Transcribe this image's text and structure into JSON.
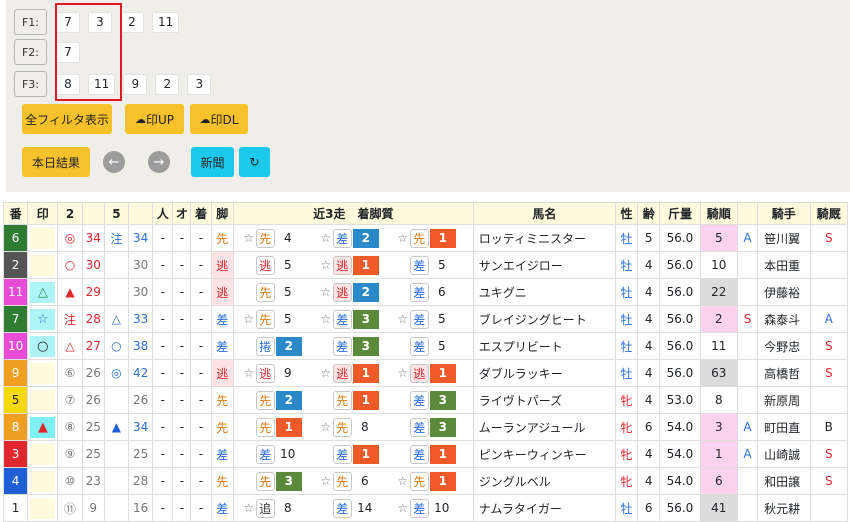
{
  "filters": [
    {
      "label": "F1:",
      "values": [
        "7",
        "3",
        "2",
        "11"
      ]
    },
    {
      "label": "F2:",
      "values": [
        "7"
      ]
    },
    {
      "label": "F3:",
      "values": [
        "8",
        "11",
        "9",
        "2",
        "3"
      ]
    }
  ],
  "buttons": {
    "show_all_filters": "全フィルタ表示",
    "upload": "印UP",
    "download": "印DL",
    "today_results": "本日結果",
    "prev": "←",
    "next": "→",
    "newspaper": "新聞",
    "refresh": "↻"
  },
  "table": {
    "headers": [
      "番",
      "印",
      "2",
      "",
      "5",
      "",
      "人",
      "オ",
      "着",
      "脚",
      "近3走　着脚質",
      "馬名",
      "性",
      "齢",
      "斤量",
      "騎順",
      "",
      "騎手",
      "騎厩"
    ],
    "rows": [
      {
        "ban": "6",
        "ban_color": "#2e7d32",
        "shirushi": "",
        "m2": "◎",
        "v2": "34",
        "m5": "注",
        "v5": "34",
        "ninki": "-",
        "o": "-",
        "chaku": "-",
        "ashi": "先",
        "recent": [
          {
            "star": "☆",
            "tag": "先",
            "pos": "4"
          },
          {
            "star": "☆",
            "tag": "差",
            "pos": "2"
          },
          {
            "star": "☆",
            "tag": "先",
            "pos": "1"
          }
        ],
        "name": "ロッティミニスター",
        "sex": "牡",
        "age": "5",
        "kinryo": "56.0",
        "kijun": "5",
        "kmark": "A",
        "kishu": "笹川翼",
        "kikyu": "S"
      },
      {
        "ban": "2",
        "ban_color": "#555555",
        "shirushi": "",
        "m2": "○",
        "v2": "30",
        "m5": "",
        "v5": "30",
        "ninki": "-",
        "o": "-",
        "chaku": "-",
        "ashi": "逃",
        "recent": [
          {
            "star": "",
            "tag": "逃",
            "pos": "5"
          },
          {
            "star": "☆",
            "tag": "逃",
            "pos": "1"
          },
          {
            "star": "",
            "tag": "差",
            "pos": "5"
          }
        ],
        "name": "サンエイジロー",
        "sex": "牡",
        "age": "4",
        "kinryo": "56.0",
        "kijun": "10",
        "kmark": "",
        "kishu": "本田重",
        "kikyu": ""
      },
      {
        "ban": "11",
        "ban_color": "#e84bd6",
        "shirushi": "△",
        "m2": "▲",
        "v2": "29",
        "m5": "",
        "v5": "30",
        "ninki": "-",
        "o": "-",
        "chaku": "-",
        "ashi": "逃",
        "recent": [
          {
            "star": "",
            "tag": "先",
            "pos": "5"
          },
          {
            "star": "☆",
            "tag": "逃",
            "pos": "2"
          },
          {
            "star": "",
            "tag": "差",
            "pos": "6"
          }
        ],
        "name": "ユキグニ",
        "sex": "牡",
        "age": "4",
        "kinryo": "56.0",
        "kijun": "22",
        "kmark": "",
        "kishu": "伊藤裕",
        "kikyu": ""
      },
      {
        "ban": "7",
        "ban_color": "#2e7d32",
        "shirushi": "☆",
        "m2": "注",
        "v2": "28",
        "m5": "△",
        "v5": "33",
        "ninki": "-",
        "o": "-",
        "chaku": "-",
        "ashi": "差",
        "recent": [
          {
            "star": "☆",
            "tag": "先",
            "pos": "5"
          },
          {
            "star": "☆",
            "tag": "差",
            "pos": "3"
          },
          {
            "star": "☆",
            "tag": "差",
            "pos": "5"
          }
        ],
        "name": "ブレイジングヒート",
        "sex": "牡",
        "age": "4",
        "kinryo": "56.0",
        "kijun": "2",
        "kmark": "S",
        "kishu": "森泰斗",
        "kikyu": "A"
      },
      {
        "ban": "10",
        "ban_color": "#e84bd6",
        "shirushi": "○",
        "m2": "△",
        "v2": "27",
        "m5": "○",
        "v5": "38",
        "ninki": "-",
        "o": "-",
        "chaku": "-",
        "ashi": "差",
        "recent": [
          {
            "star": "",
            "tag": "捲",
            "pos": "2"
          },
          {
            "star": "",
            "tag": "差",
            "pos": "3"
          },
          {
            "star": "",
            "tag": "差",
            "pos": "5"
          }
        ],
        "name": "エスプリビート",
        "sex": "牡",
        "age": "4",
        "kinryo": "56.0",
        "kijun": "11",
        "kmark": "",
        "kishu": "今野忠",
        "kikyu": "S"
      },
      {
        "ban": "9",
        "ban_color": "#f0a020",
        "shirushi": "",
        "m2": "⑥",
        "v2": "26",
        "m5": "◎",
        "v5": "42",
        "ninki": "-",
        "o": "-",
        "chaku": "-",
        "ashi": "逃",
        "recent": [
          {
            "star": "☆",
            "tag": "逃",
            "pos": "9"
          },
          {
            "star": "☆",
            "tag": "逃",
            "pos": "1"
          },
          {
            "star": "☆",
            "tag": "逃",
            "pos": "1"
          }
        ],
        "name": "ダブルラッキー",
        "sex": "牡",
        "age": "4",
        "kinryo": "56.0",
        "kijun": "63",
        "kmark": "",
        "kishu": "高橋哲",
        "kikyu": "S"
      },
      {
        "ban": "5",
        "ban_color": "#f5d90a",
        "shirushi": "",
        "m2": "⑦",
        "v2": "26",
        "m5": "",
        "v5": "26",
        "ninki": "-",
        "o": "-",
        "chaku": "-",
        "ashi": "先",
        "recent": [
          {
            "star": "",
            "tag": "先",
            "pos": "2"
          },
          {
            "star": "",
            "tag": "先",
            "pos": "1"
          },
          {
            "star": "",
            "tag": "差",
            "pos": "3"
          }
        ],
        "name": "ライヴトパーズ",
        "sex": "牝",
        "age": "4",
        "kinryo": "53.0",
        "kijun": "8",
        "kmark": "",
        "kishu": "新原周",
        "kikyu": ""
      },
      {
        "ban": "8",
        "ban_color": "#f0a020",
        "shirushi": "▲",
        "m2": "⑧",
        "v2": "25",
        "m5": "▲",
        "v5": "34",
        "ninki": "-",
        "o": "-",
        "chaku": "-",
        "ashi": "先",
        "recent": [
          {
            "star": "",
            "tag": "先",
            "pos": "1"
          },
          {
            "star": "☆",
            "tag": "先",
            "pos": "8"
          },
          {
            "star": "",
            "tag": "差",
            "pos": "3"
          }
        ],
        "name": "ムーランアジュール",
        "sex": "牝",
        "age": "6",
        "kinryo": "54.0",
        "kijun": "3",
        "kmark": "A",
        "kishu": "町田直",
        "kikyu": "B"
      },
      {
        "ban": "3",
        "ban_color": "#e0262f",
        "shirushi": "",
        "m2": "⑨",
        "v2": "25",
        "m5": "",
        "v5": "25",
        "ninki": "-",
        "o": "-",
        "chaku": "-",
        "ashi": "差",
        "recent": [
          {
            "star": "",
            "tag": "差",
            "pos": "10"
          },
          {
            "star": "",
            "tag": "差",
            "pos": "1"
          },
          {
            "star": "",
            "tag": "差",
            "pos": "1"
          }
        ],
        "name": "ピンキーウィンキー",
        "sex": "牝",
        "age": "4",
        "kinryo": "54.0",
        "kijun": "1",
        "kmark": "A",
        "kishu": "山崎誠",
        "kikyu": "S"
      },
      {
        "ban": "4",
        "ban_color": "#1f5fd6",
        "shirushi": "",
        "m2": "⑩",
        "v2": "23",
        "m5": "",
        "v5": "28",
        "ninki": "-",
        "o": "-",
        "chaku": "-",
        "ashi": "先",
        "recent": [
          {
            "star": "",
            "tag": "先",
            "pos": "3"
          },
          {
            "star": "☆",
            "tag": "先",
            "pos": "6"
          },
          {
            "star": "☆",
            "tag": "先",
            "pos": "1"
          }
        ],
        "name": "ジングルベル",
        "sex": "牝",
        "age": "4",
        "kinryo": "54.0",
        "kijun": "6",
        "kmark": "",
        "kishu": "和田譲",
        "kikyu": "S"
      },
      {
        "ban": "1",
        "ban_color": "#ffffff",
        "shirushi": "",
        "m2": "⑪",
        "v2": "9",
        "m5": "",
        "v5": "16",
        "ninki": "-",
        "o": "-",
        "chaku": "-",
        "ashi": "差",
        "recent": [
          {
            "star": "☆",
            "tag": "追",
            "pos": "8"
          },
          {
            "star": "",
            "tag": "差",
            "pos": "14"
          },
          {
            "star": "☆",
            "tag": "差",
            "pos": "10"
          }
        ],
        "name": "ナムラタイガー",
        "sex": "牡",
        "age": "6",
        "kinryo": "56.0",
        "kijun": "41",
        "kmark": "",
        "kishu": "秋元耕",
        "kikyu": ""
      }
    ]
  }
}
